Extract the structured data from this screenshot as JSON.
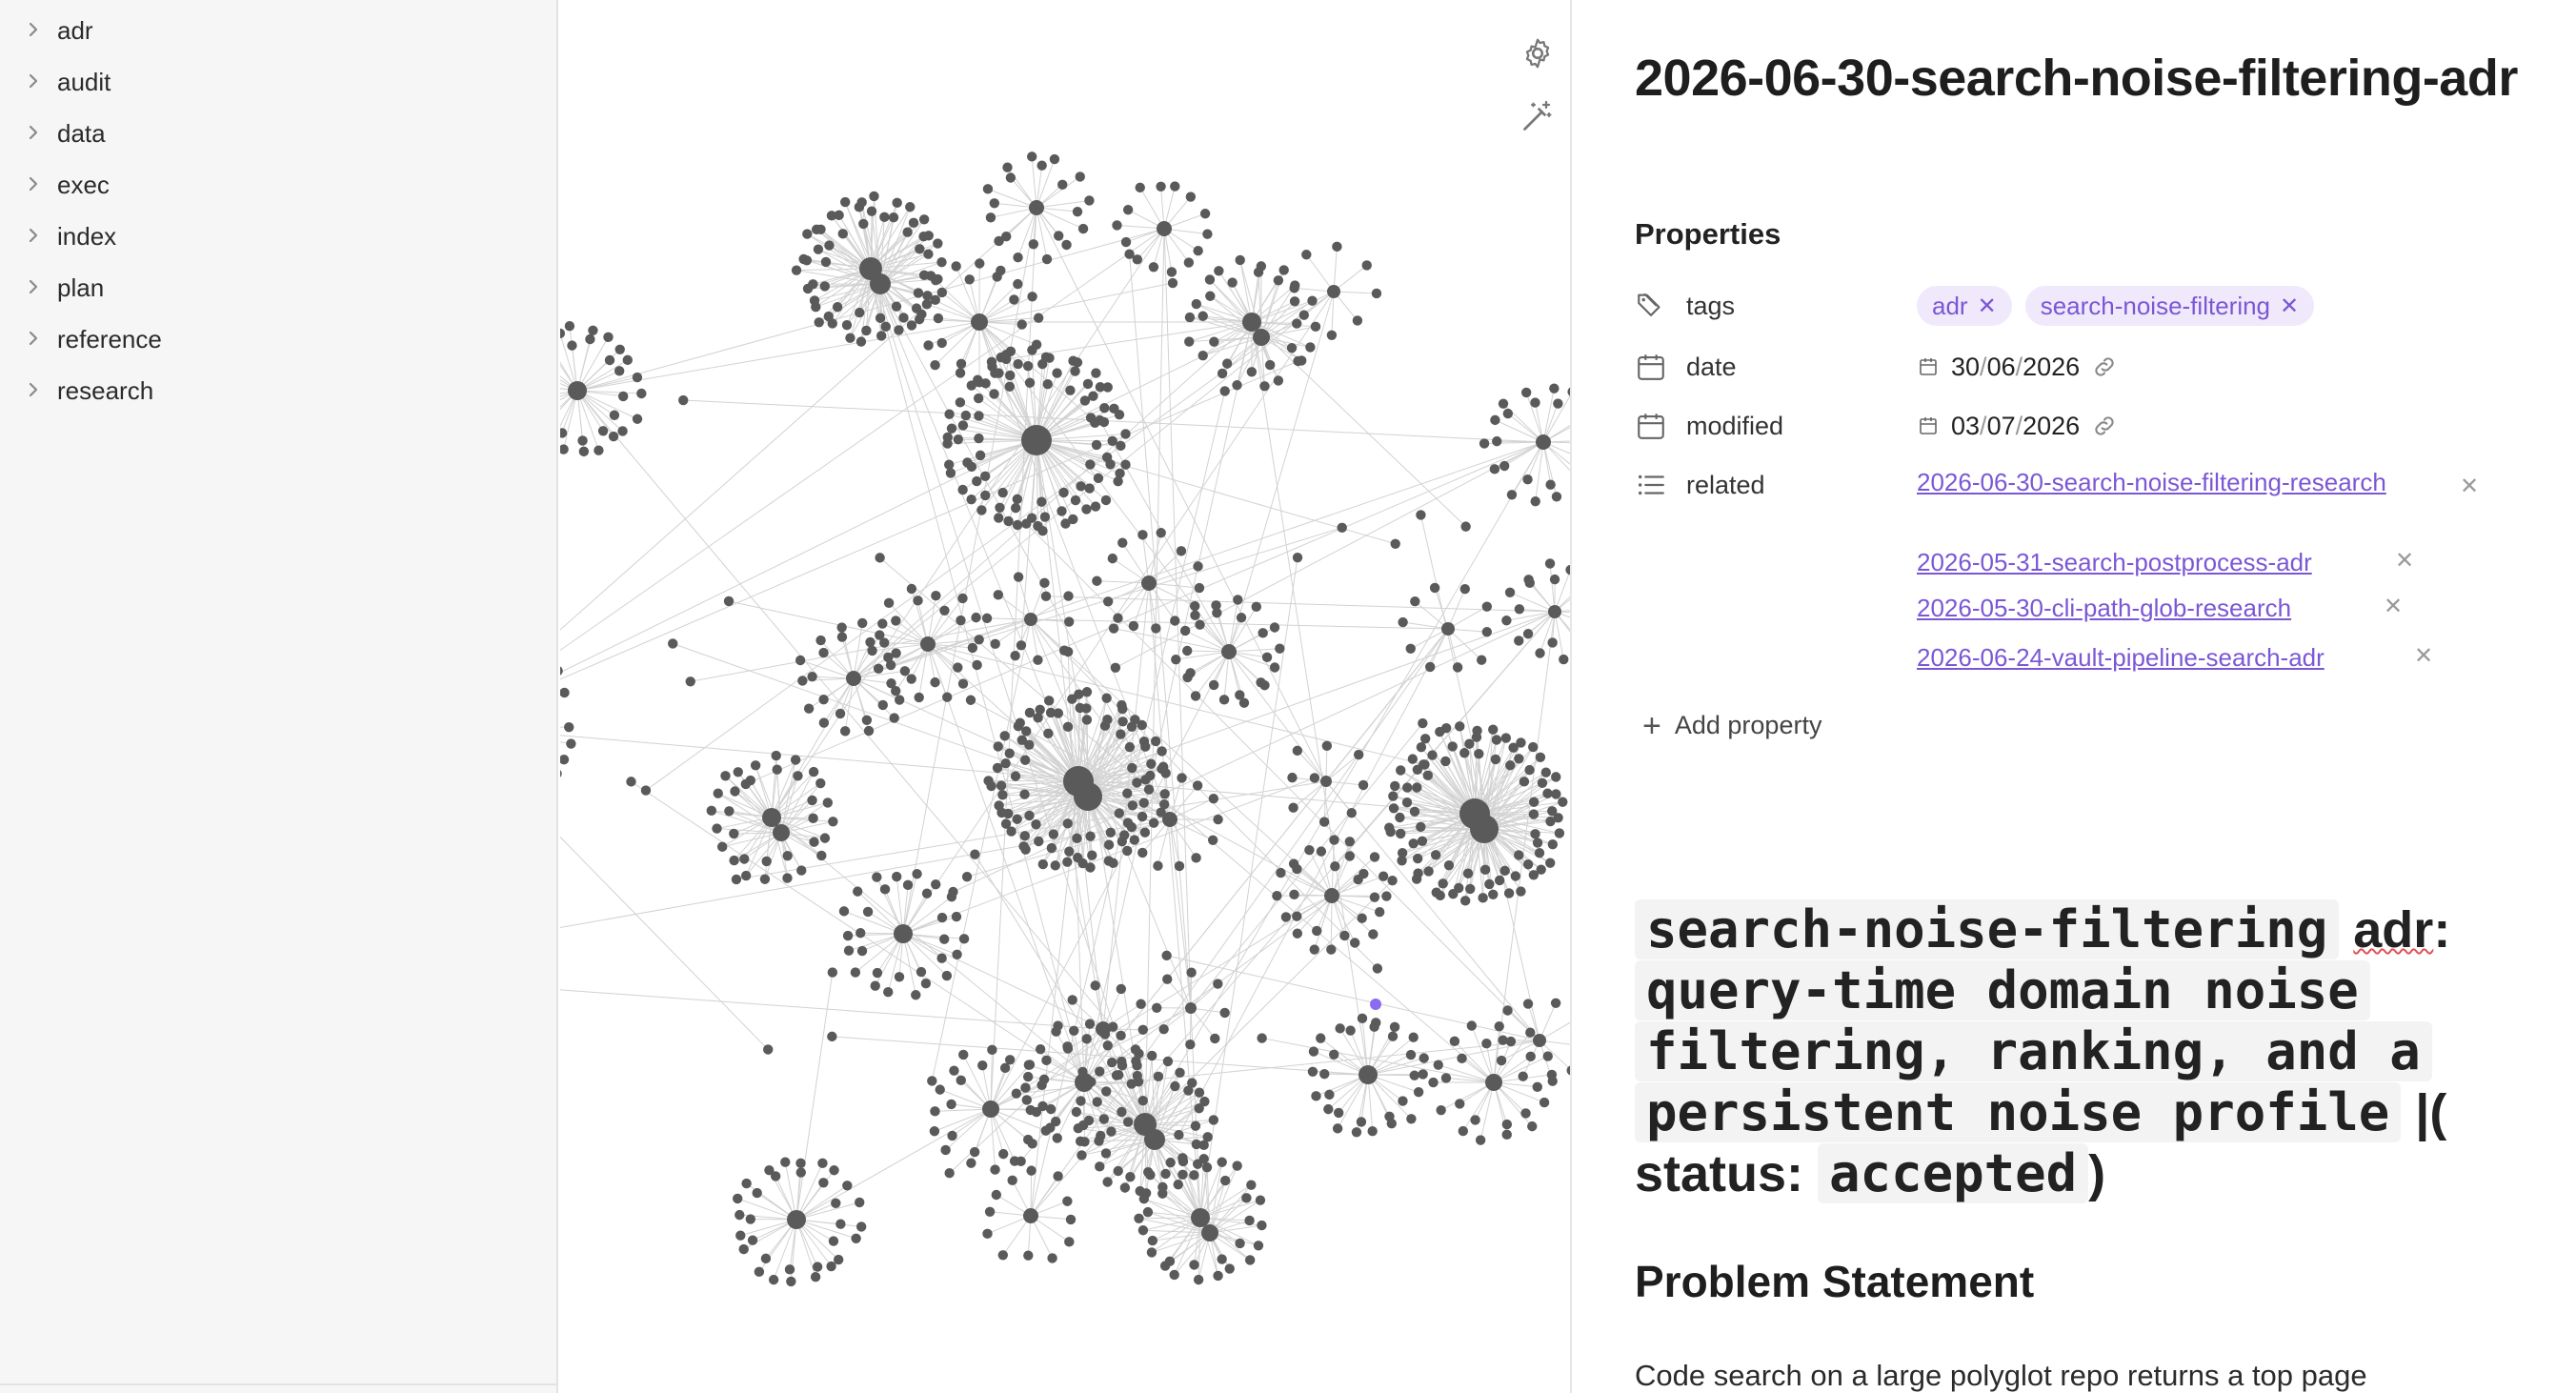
{
  "sidebar": {
    "items": [
      {
        "label": "adr"
      },
      {
        "label": "audit"
      },
      {
        "label": "data"
      },
      {
        "label": "exec"
      },
      {
        "label": "index"
      },
      {
        "label": "plan"
      },
      {
        "label": "reference"
      },
      {
        "label": "research"
      }
    ]
  },
  "graph": {
    "controls": [
      {
        "icon": "gear-icon"
      },
      {
        "icon": "magic-wand-icon"
      }
    ],
    "node_color": "#5a5a5a",
    "edge_color": "#d2d2d2",
    "active_node_color": "#8a6cf0"
  },
  "note": {
    "title": "2026-06-30-search-noise-filtering-adr",
    "properties_heading": "Properties",
    "properties": {
      "tags": {
        "key": "tags",
        "values": [
          "adr",
          "search-noise-filtering"
        ]
      },
      "date": {
        "key": "date",
        "dd": "30",
        "mm": "06",
        "yyyy": "2026"
      },
      "modified": {
        "key": "modified",
        "dd": "03",
        "mm": "07",
        "yyyy": "2026"
      },
      "related": {
        "key": "related",
        "links": [
          "2026-06-30-search-noise-filtering-research",
          "2026-05-31-search-postprocess-adr",
          "2026-05-30-cli-path-glob-research",
          "2026-06-24-vault-pipeline-search-adr"
        ]
      }
    },
    "add_property_label": "Add property",
    "heading": {
      "code_part_1": "search-noise-filtering",
      "word_adr": "adr",
      "colon": ":",
      "code_part_2": "query-time domain noise",
      "code_part_3": "filtering, ranking, and a",
      "code_part_4": "persistent noise profile",
      "pipe_paren": "|(",
      "status_label": "status:",
      "status_value": "accepted",
      "close_paren": ")"
    },
    "section_heading": "Problem Statement",
    "body_line": "Code search on a large polyglot repo returns a top page"
  },
  "colors": {
    "accent": "#7b57d4",
    "pill_bg": "#efe9fb",
    "sidebar_bg": "#f6f6f6"
  }
}
